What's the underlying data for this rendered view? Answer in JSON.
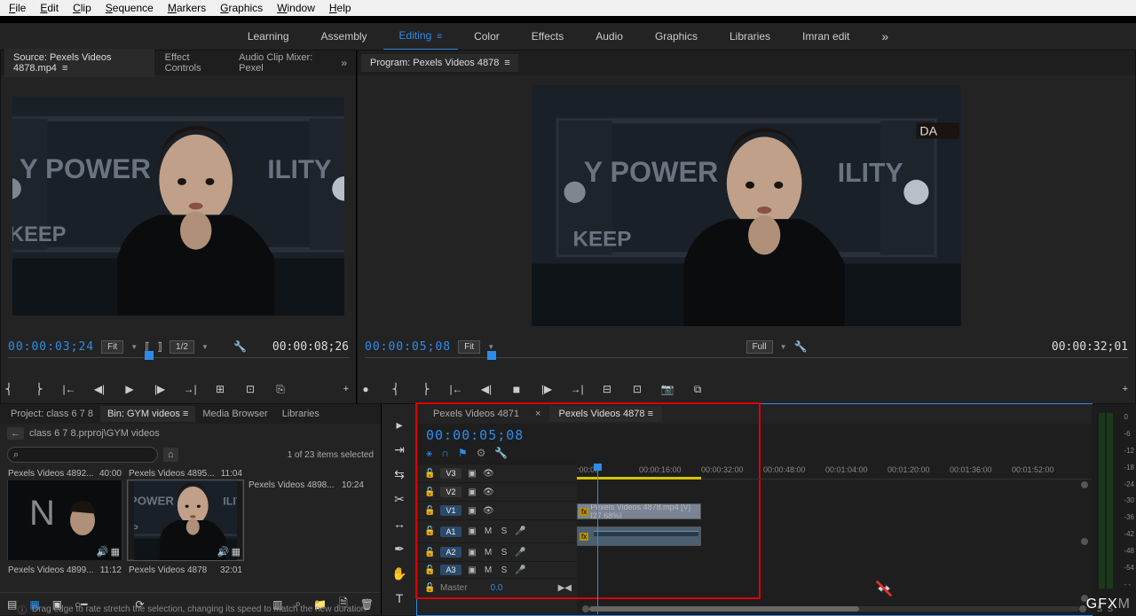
{
  "menubar": {
    "file": "File",
    "edit": "Edit",
    "clip": "Clip",
    "sequence": "Sequence",
    "markers": "Markers",
    "graphics": "Graphics",
    "window": "Window",
    "help": "Help"
  },
  "workspaces": {
    "learning": "Learning",
    "assembly": "Assembly",
    "editing": "Editing",
    "color": "Color",
    "effects": "Effects",
    "audio": "Audio",
    "graphics": "Graphics",
    "libraries": "Libraries",
    "custom": "Imran edit"
  },
  "source": {
    "tabs": {
      "source": "Source: Pexels Videos 4878.mp4",
      "fx": "Effect Controls",
      "mixer": "Audio Clip Mixer: Pexel"
    },
    "tc_in": "00:00:03;24",
    "tc_out": "00:00:08;26",
    "fit": "Fit",
    "zoom": "1/2"
  },
  "program": {
    "title": "Program: Pexels Videos 4878",
    "tc_in": "00:00:05;08",
    "tc_out": "00:00:32;01",
    "fit": "Fit",
    "full": "Full"
  },
  "project": {
    "tabs": {
      "project": "Project: class 6 7 8",
      "bin": "Bin: GYM videos",
      "media": "Media Browser",
      "lib": "Libraries"
    },
    "breadcrumb": "class 6 7 8.prproj\\GYM videos",
    "search_ph": "⌕",
    "info": "1 of 23 items selected",
    "items": [
      {
        "name": "Pexels Videos 4892...",
        "dur_top": "40:00",
        "dur_bot": "11:12",
        "sub": "Pexels Videos 4899..."
      },
      {
        "name": "Pexels Videos 4895...",
        "dur_top": "11:04",
        "dur_bot": "32:01",
        "sub": "Pexels Videos 4878"
      },
      {
        "name": "Pexels Videos 4898...",
        "dur_top": "10:24"
      }
    ]
  },
  "timeline": {
    "tabs": {
      "a": "Pexels Videos 4871",
      "b": "Pexels Videos 4878"
    },
    "tc": "00:00:05;08",
    "ticks": [
      ":00:00",
      "00:00:16:00",
      "00:00:32:00",
      "00:00:48:00",
      "00:01:04:00",
      "00:01:20:00",
      "00:01:36:00",
      "00:01:52:00"
    ],
    "tracks": {
      "v3": "V3",
      "v2": "V2",
      "v1": "V1",
      "a1": "A1",
      "a2": "A2",
      "a3": "A3",
      "master": "Master",
      "master_val": "0.0"
    },
    "clip_v": "Pexels Videos 4878.mp4 [V] [27.68%]",
    "clip_a": "fx"
  },
  "meters": [
    "0",
    "-6",
    "-12",
    "-18",
    "-24",
    "-30",
    "-36",
    "-42",
    "-48",
    "-54",
    "- -"
  ],
  "status": "Drag edge to rate stretch the selection, changing its speed to match the new duration",
  "logo1": "GFX",
  "logo2": "M"
}
